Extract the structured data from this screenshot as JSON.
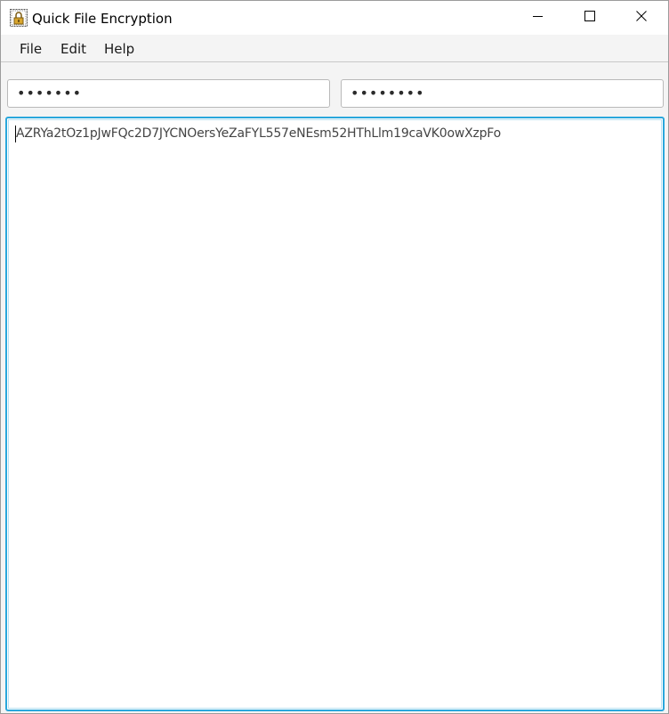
{
  "window": {
    "title": "Quick File Encryption",
    "icon": "lock-file-icon"
  },
  "controls": {
    "minimize_icon": "minimize-icon",
    "maximize_icon": "maximize-icon",
    "close_icon": "close-icon"
  },
  "menu": {
    "items": [
      {
        "label": "File"
      },
      {
        "label": "Edit"
      },
      {
        "label": "Help"
      }
    ]
  },
  "fields": {
    "password1_value": "•••••••",
    "password2_value": "••••••••"
  },
  "editor": {
    "content": "AZRYa2tOz1pJwFQc2D7JYCNOersYeZaFYL557eNEsm52HThLlm19caVK0owXzpFo"
  },
  "colors": {
    "focus_border": "#29a7dc",
    "background": "#f4f4f4"
  }
}
